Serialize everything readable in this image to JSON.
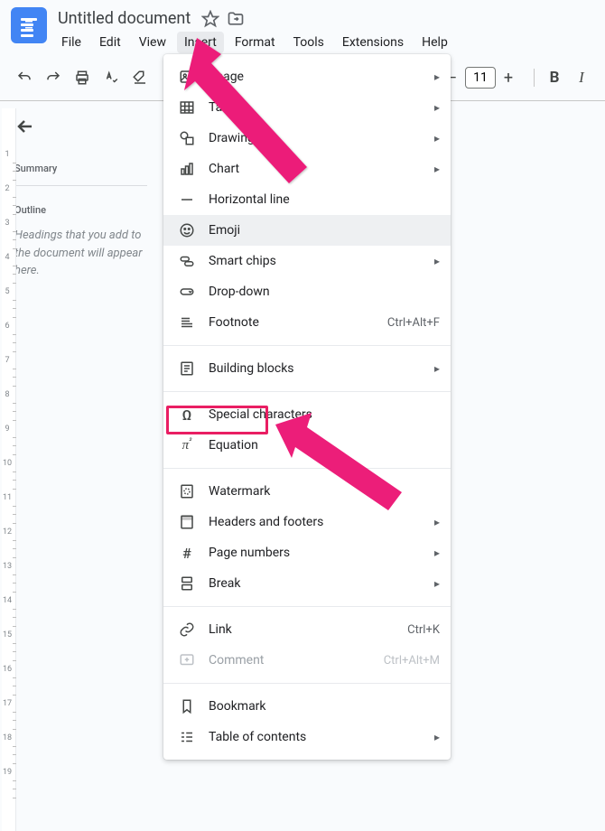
{
  "header": {
    "title": "Untitled document"
  },
  "menubar": {
    "items": [
      "File",
      "Edit",
      "View",
      "Insert",
      "Format",
      "Tools",
      "Extensions",
      "Help"
    ],
    "activeIndex": 3
  },
  "toolbar": {
    "fontSize": "11"
  },
  "sidebar": {
    "summary_label": "Summary",
    "outline_label": "Outline",
    "outline_hint": "Headings that you add to the document will appear here."
  },
  "dropdown": {
    "groups": [
      [
        {
          "icon": "image",
          "label": "Image",
          "submenu": true
        },
        {
          "icon": "table",
          "label": "Table",
          "submenu": true
        },
        {
          "icon": "drawing",
          "label": "Drawing",
          "submenu": true
        },
        {
          "icon": "chart",
          "label": "Chart",
          "submenu": true
        },
        {
          "icon": "hr",
          "label": "Horizontal line"
        },
        {
          "icon": "emoji",
          "label": "Emoji",
          "hover": true
        },
        {
          "icon": "chips",
          "label": "Smart chips",
          "submenu": true
        },
        {
          "icon": "dropdown",
          "label": "Drop-down"
        },
        {
          "icon": "footnote",
          "label": "Footnote",
          "shortcut": "Ctrl+Alt+F"
        }
      ],
      [
        {
          "icon": "blocks",
          "label": "Building blocks",
          "submenu": true
        }
      ],
      [
        {
          "icon": "omega",
          "label": "Special characters"
        },
        {
          "icon": "pi",
          "label": "Equation"
        }
      ],
      [
        {
          "icon": "watermark",
          "label": "Watermark"
        },
        {
          "icon": "headers",
          "label": "Headers and footers",
          "submenu": true
        },
        {
          "icon": "hash",
          "label": "Page numbers",
          "submenu": true
        },
        {
          "icon": "break",
          "label": "Break",
          "submenu": true
        }
      ],
      [
        {
          "icon": "link",
          "label": "Link",
          "shortcut": "Ctrl+K"
        },
        {
          "icon": "comment",
          "label": "Comment",
          "shortcut": "Ctrl+Alt+M",
          "disabled": true
        }
      ],
      [
        {
          "icon": "bookmark",
          "label": "Bookmark"
        },
        {
          "icon": "toc",
          "label": "Table of contents",
          "submenu": true
        }
      ]
    ]
  },
  "ruler": {
    "labels": [
      "1",
      "2",
      "3",
      "4",
      "5",
      "6",
      "7",
      "8",
      "9",
      "10",
      "11",
      "12",
      "13",
      "14",
      "15",
      "16",
      "17",
      "18",
      "19"
    ]
  }
}
